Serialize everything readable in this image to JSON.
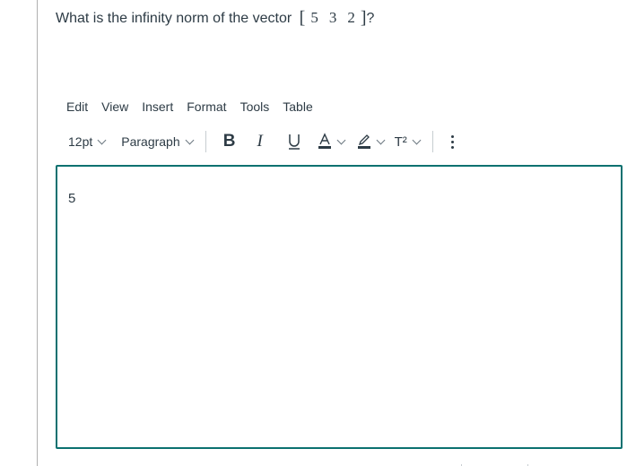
{
  "question": {
    "text": "What is the infinity norm of the vector",
    "vector": [
      "5",
      "3",
      "2"
    ],
    "open_bracket": "[",
    "close_bracket": "]",
    "suffix": "?"
  },
  "editor": {
    "menu": [
      "Edit",
      "View",
      "Insert",
      "Format",
      "Tools",
      "Table"
    ],
    "toolbar": {
      "font_size": "12pt",
      "block_format": "Paragraph",
      "bold_label": "B",
      "italic_label": "I",
      "superscript_label": "T²"
    },
    "content": "5",
    "colors": {
      "border": "#0b7170",
      "text": "#2d3b45"
    }
  }
}
